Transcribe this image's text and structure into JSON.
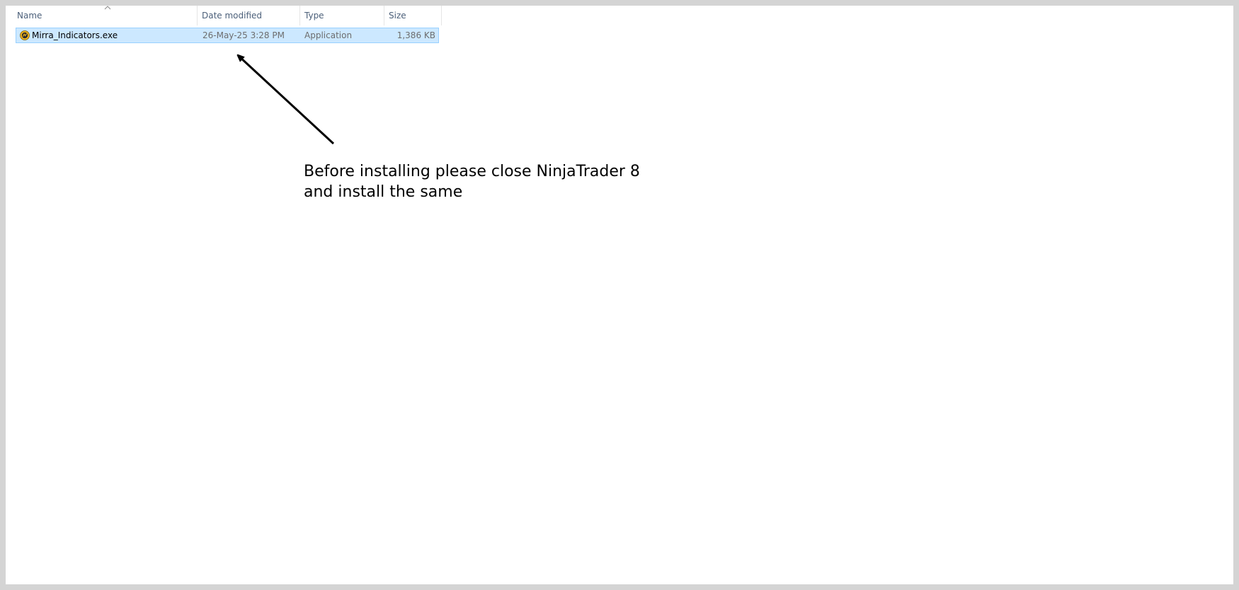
{
  "columns": {
    "name": "Name",
    "date_modified": "Date modified",
    "type": "Type",
    "size": "Size"
  },
  "files": [
    {
      "name": "Mirra_Indicators.exe",
      "date_modified": "26-May-25 3:28 PM",
      "type": "Application",
      "size": "1,386 KB",
      "selected": true,
      "icon": "ninjatrader-app-icon"
    }
  ],
  "annotation": {
    "line1": "Before installing please close NinjaTrader 8",
    "line2": "and install the same"
  },
  "colors": {
    "selection_fill": "#cce8ff",
    "selection_border": "#99d1ff",
    "header_text": "#4c607a"
  }
}
